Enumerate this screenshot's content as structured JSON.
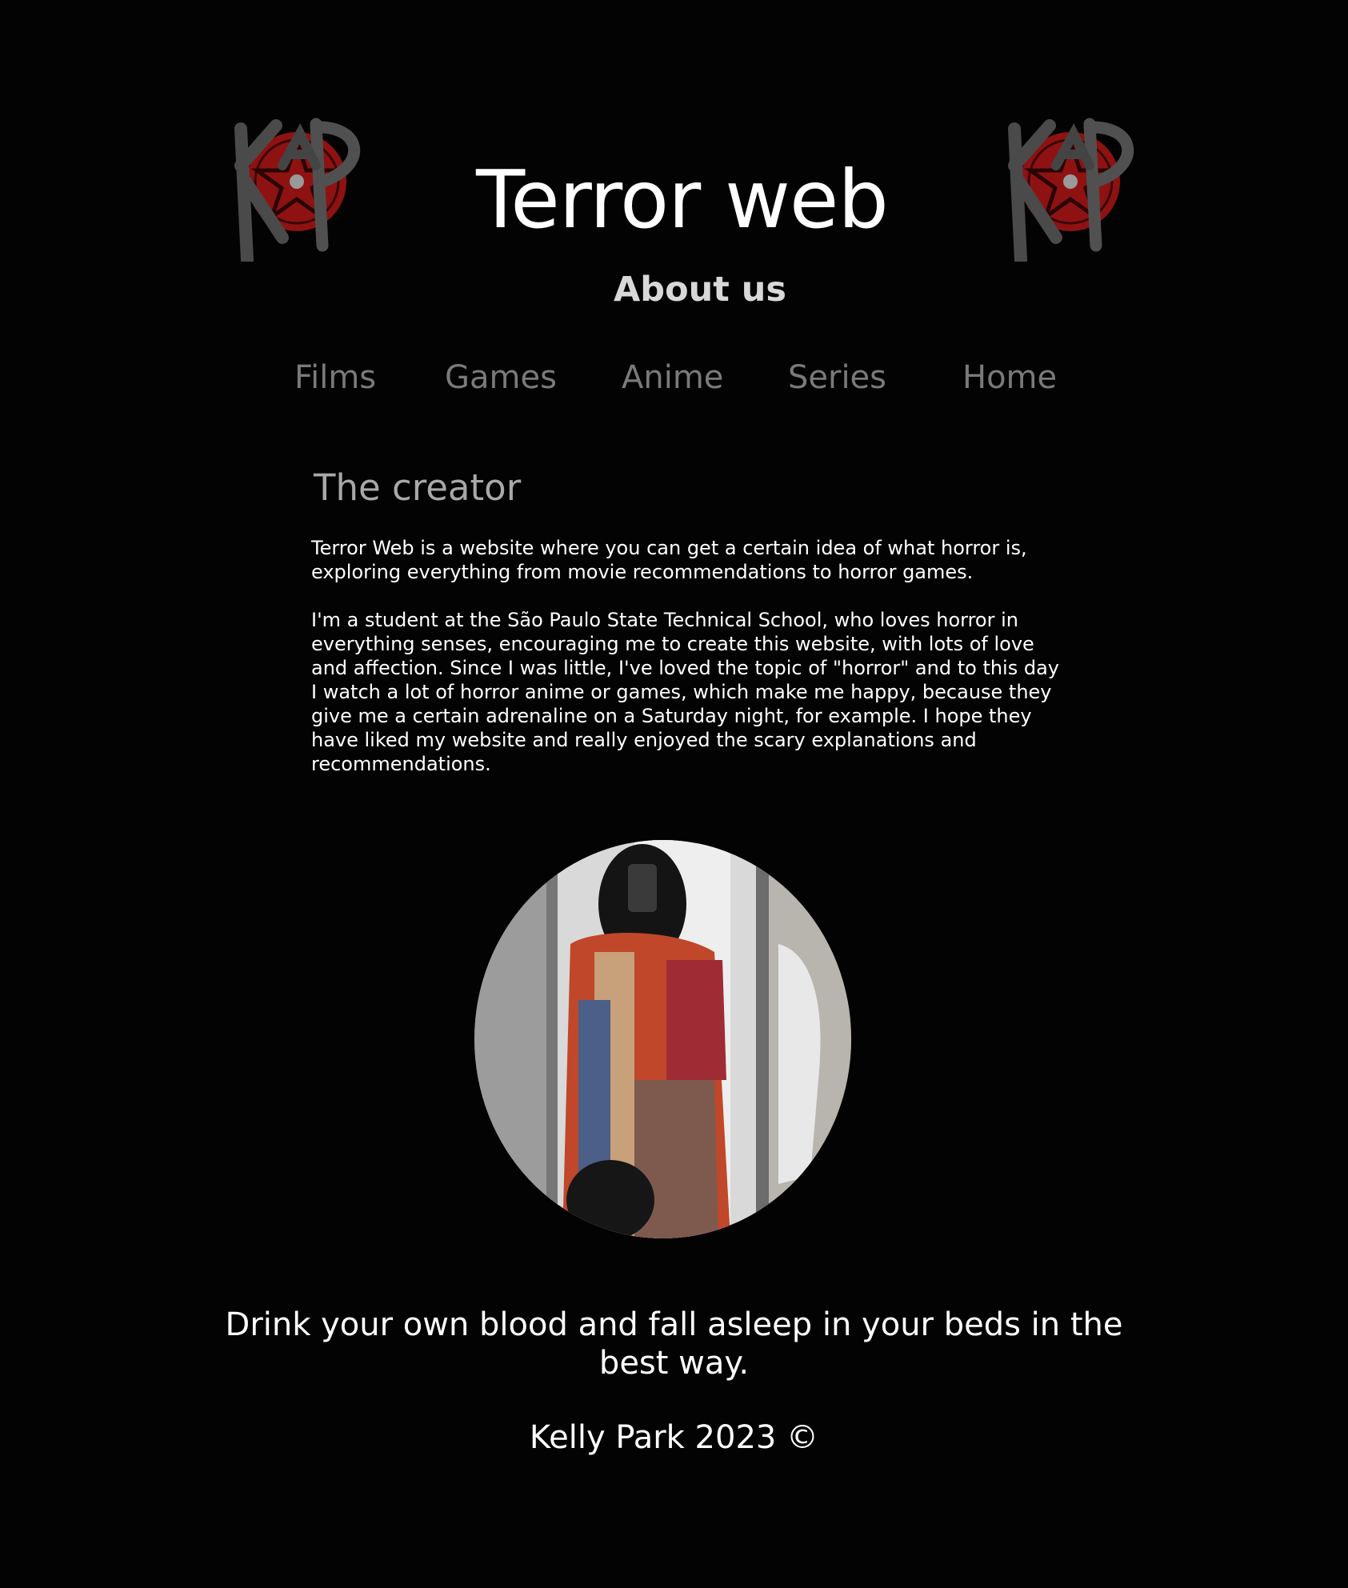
{
  "header": {
    "title": "Terror web",
    "subtitle": "About us",
    "logo_left": {
      "icon": "pentagram-logo-icon",
      "brand_color": "#9e1414"
    },
    "logo_right": {
      "icon": "pentagram-logo-icon",
      "brand_color": "#9e1414"
    }
  },
  "nav": {
    "items": [
      {
        "label": "Films"
      },
      {
        "label": "Games"
      },
      {
        "label": "Anime"
      },
      {
        "label": "Series"
      },
      {
        "label": "Home"
      }
    ]
  },
  "main": {
    "heading": "The creator",
    "paragraphs": [
      "Terror Web is a website where you can get a certain idea of what horror is, exploring everything from movie recommendations to horror games.",
      "I'm a student at the São Paulo State Technical School, who loves horror in everything senses, encouraging me to create this website, with lots of love and affection. Since I was little, I've loved the topic of \"horror\" and to this day I watch a lot of horror anime or games, which make me happy, because they give me a certain adrenaline on a Saturday night, for example. I hope they have liked my website and really enjoyed the scary explanations and recommendations."
    ]
  },
  "footer": {
    "tagline": "Drink your own blood and fall asleep in your beds in the best way.",
    "copyright": "Kelly Park 2023 ©"
  },
  "colors": {
    "background": "#030303",
    "nav_text": "#7a7a7a",
    "heading_text": "#a8a8a8",
    "accent_red": "#9e1414"
  }
}
